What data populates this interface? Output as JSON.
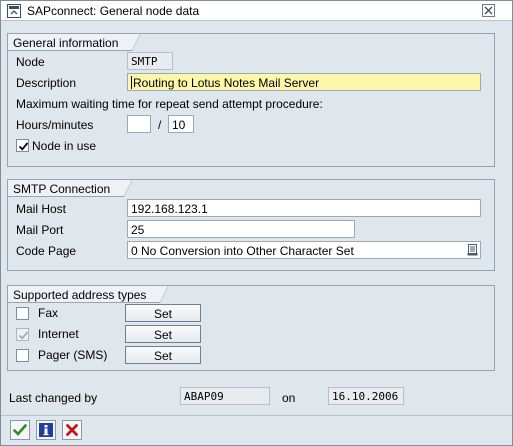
{
  "window": {
    "title": "SAPconnect: General node data"
  },
  "general_information": {
    "group_title": "General information",
    "node_label": "Node",
    "node_value": "SMTP",
    "description_label": "Description",
    "description_value": "Routing to Lotus Notes Mail Server",
    "max_wait_text": "Maximum waiting time for repeat send attempt procedure:",
    "hours_minutes_label": "Hours/minutes",
    "hours_value": "",
    "separator": "/",
    "minutes_value": "10",
    "node_in_use_label": "Node in use",
    "node_in_use_checked": true
  },
  "smtp_connection": {
    "group_title": "SMTP Connection",
    "mail_host_label": "Mail Host",
    "mail_host_value": "192.168.123.1",
    "mail_port_label": "Mail Port",
    "mail_port_value": "25",
    "code_page_label": "Code Page",
    "code_page_value": "0 No Conversion into Other Character Set"
  },
  "supported_address_types": {
    "group_title": "Supported address types",
    "items": [
      {
        "label": "Fax",
        "checked": false,
        "enabled": true,
        "button_label": "Set"
      },
      {
        "label": "Internet",
        "checked": true,
        "enabled": false,
        "button_label": "Set"
      },
      {
        "label": "Pager (SMS)",
        "checked": false,
        "enabled": true,
        "button_label": "Set"
      }
    ]
  },
  "last_changed": {
    "label": "Last changed by",
    "user": "ABAP09",
    "on_label": "on",
    "date": "16.10.2006"
  },
  "toolbar": {
    "icons": [
      "confirm-icon",
      "info-icon",
      "cancel-icon"
    ]
  },
  "colors": {
    "background": "#dfe6ec",
    "highlight_field": "#fef6a9",
    "confirm_green": "#2e8b23",
    "info_blue": "#1f3f9a",
    "cancel_red": "#c0191c"
  }
}
